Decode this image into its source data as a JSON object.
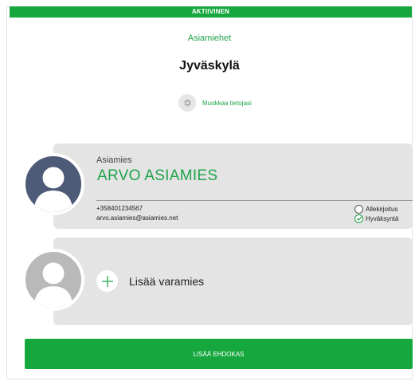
{
  "status": {
    "label": "AKTIIVINEN"
  },
  "header": {
    "role": "Asiamiehet",
    "city": "Jyväskylä",
    "edit_label": "Muokkaa tietojasi"
  },
  "agent": {
    "title": "Asiamies",
    "name": "ARVO ASIAMIES",
    "phone": "+358401234567",
    "email": "arvo.asiamies@asiamies.net",
    "checks": [
      {
        "label": "Allekirjoitus",
        "checked": false
      },
      {
        "label": "Hyväksyntä",
        "checked": true
      }
    ]
  },
  "substitute": {
    "add_label": "Lisää varamies"
  },
  "actions": {
    "add_candidate_label": "LISÄÄ EHDOKAS"
  },
  "colors": {
    "accent": "#16a83f",
    "accent_text": "#1fa34a",
    "card": "#e4e4e4",
    "avatar_primary": "#4d5a78",
    "avatar_empty": "#b9b9b9"
  },
  "icons": [
    "gear-icon",
    "person-icon",
    "plus-icon",
    "check-icon"
  ]
}
